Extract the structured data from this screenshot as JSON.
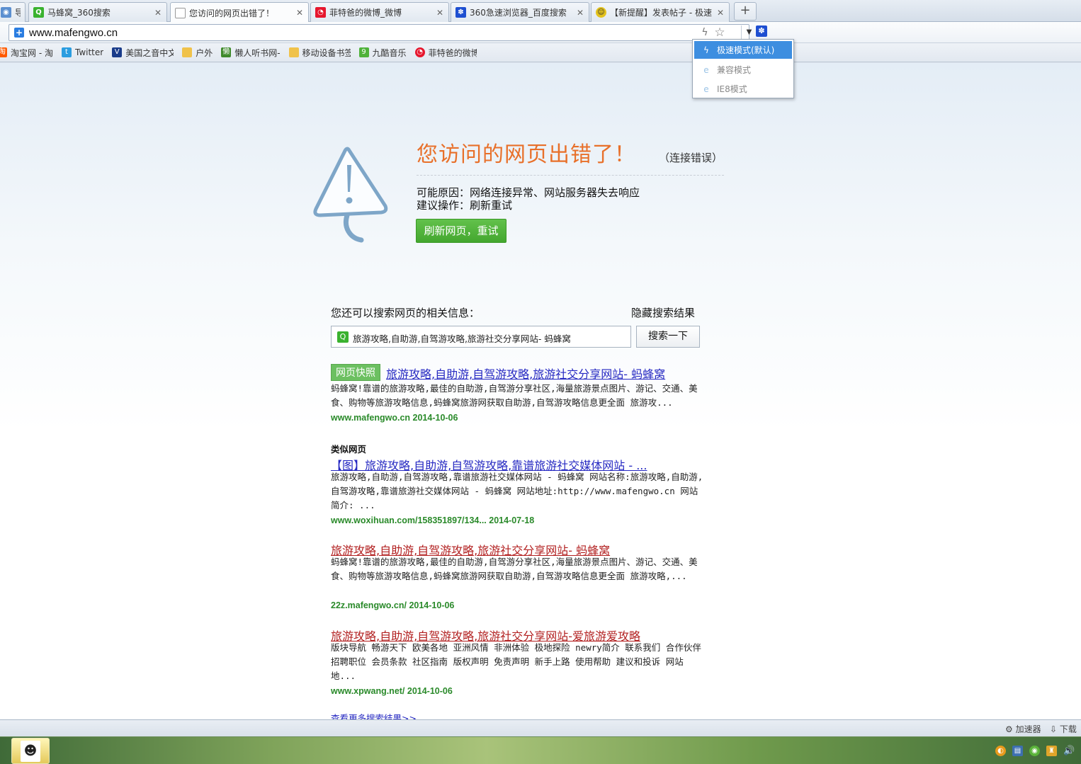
{
  "tabs": [
    {
      "label": "导",
      "icon": "globe-icon"
    },
    {
      "label": "马蜂窝_360搜索",
      "icon": "360-search-icon"
    },
    {
      "label": "您访问的网页出错了！",
      "icon": "page-icon"
    },
    {
      "label": "菲特爸的微博_微博",
      "icon": "weibo-icon"
    },
    {
      "label": "360急速浏览器_百度搜索",
      "icon": "baidu-paw-icon"
    },
    {
      "label": "【新提醒】发表帖子 - 极速",
      "icon": "smiley-icon"
    }
  ],
  "address": {
    "url": "www.mafengwo.cn"
  },
  "bookmarks": [
    {
      "label": "淘宝网 - 淘",
      "icon": "taobao-icon"
    },
    {
      "label": "Twitter",
      "icon": "twitter-icon"
    },
    {
      "label": "美国之音中文",
      "icon": "voa-icon"
    },
    {
      "label": "户外",
      "icon": "folder-icon"
    },
    {
      "label": "懒人听书网-",
      "icon": "lanren-icon"
    },
    {
      "label": "移动设备书签",
      "icon": "folder-icon"
    },
    {
      "label": "九酷音乐",
      "icon": "jiuku-icon"
    },
    {
      "label": "菲特爸的微博",
      "icon": "weibo-icon"
    }
  ],
  "mode_menu": [
    {
      "label": "极速模式(默认)",
      "icon": "bolt-icon",
      "selected": true
    },
    {
      "label": "兼容模式",
      "icon": "ie-icon",
      "selected": false
    },
    {
      "label": "IE8模式",
      "icon": "ie-icon",
      "selected": false
    }
  ],
  "error": {
    "title": "您访问的网页出错了！",
    "type": "（连接错误）",
    "reason": "可能原因：网络连接异常、网站服务器失去响应",
    "suggestion": "建议操作：刷新重试",
    "retry_button": "刷新网页，重试"
  },
  "search": {
    "prompt": "您还可以搜索网页的相关信息：",
    "hide_results": "隐藏搜索结果",
    "query": "旅游攻略,自助游,自驾游攻略,旅游社交分享网站- 蚂蜂窝",
    "button": "搜索一下"
  },
  "results": {
    "snapshot_label": "网页快照",
    "main": {
      "title": "旅游攻略,自助游,自驾游攻略,旅游社交分享网站- 蚂蜂窝",
      "desc": "蚂蜂窝!靠谱的旅游攻略,最佳的自助游,自驾游分享社区,海量旅游景点图片、游记、交通、美食、购物等旅游攻略信息,蚂蜂窝旅游网获取自助游,自驾游攻略信息更全面 旅游攻...",
      "url": "www.mafengwo.cn  2014-10-06"
    },
    "similar_label": "类似网页",
    "items": [
      {
        "title": "【图】旅游攻略,自助游,自驾游攻略,靠谱旅游社交媒体网站 - ...",
        "desc": "旅游攻略,自助游,自驾游攻略,靠谱旅游社交媒体网站 - 蚂蜂窝 网站名称:旅游攻略,自助游,自驾游攻略,靠谱旅游社交媒体网站 - 蚂蜂窝 网站地址:http://www.mafengwo.cn 网站简介: ...",
        "url": "www.woxihuan.com/158351897/134... 2014-07-18"
      },
      {
        "title": "旅游攻略,自助游,自驾游攻略,旅游社交分享网站- 蚂蜂窝",
        "desc": "蚂蜂窝!靠谱的旅游攻略,最佳的自助游,自驾游分享社区,海量旅游景点图片、游记、交通、美食、购物等旅游攻略信息,蚂蜂窝旅游网获取自助游,自驾游攻略信息更全面 旅游攻略,...",
        "url": "22z.mafengwo.cn/ 2014-10-06"
      },
      {
        "title": "旅游攻略,自助游,自驾游攻略,旅游社交分享网站-爱旅游爱攻略",
        "desc": "版块导航 畅游天下 欧美各地 亚洲风情 非洲体验 极地探险 newry简介 联系我们 合作伙伴 招聘职位 会员条款 社区指南 版权声明 免责声明 新手上路 使用帮助 建议和投诉 网站地...",
        "url": "www.xpwang.net/ 2014-10-06"
      }
    ],
    "more_link": "查看更多搜索结果>>"
  },
  "statusbar": {
    "accelerator": "加速器",
    "download": "下载"
  },
  "colors": {
    "accent_orange": "#e8702a",
    "button_green": "#4fb23a",
    "link_blue": "#2528c2",
    "link_red": "#b21f1f",
    "url_green": "#2a8a2a",
    "menu_selected": "#3d8ee0"
  }
}
